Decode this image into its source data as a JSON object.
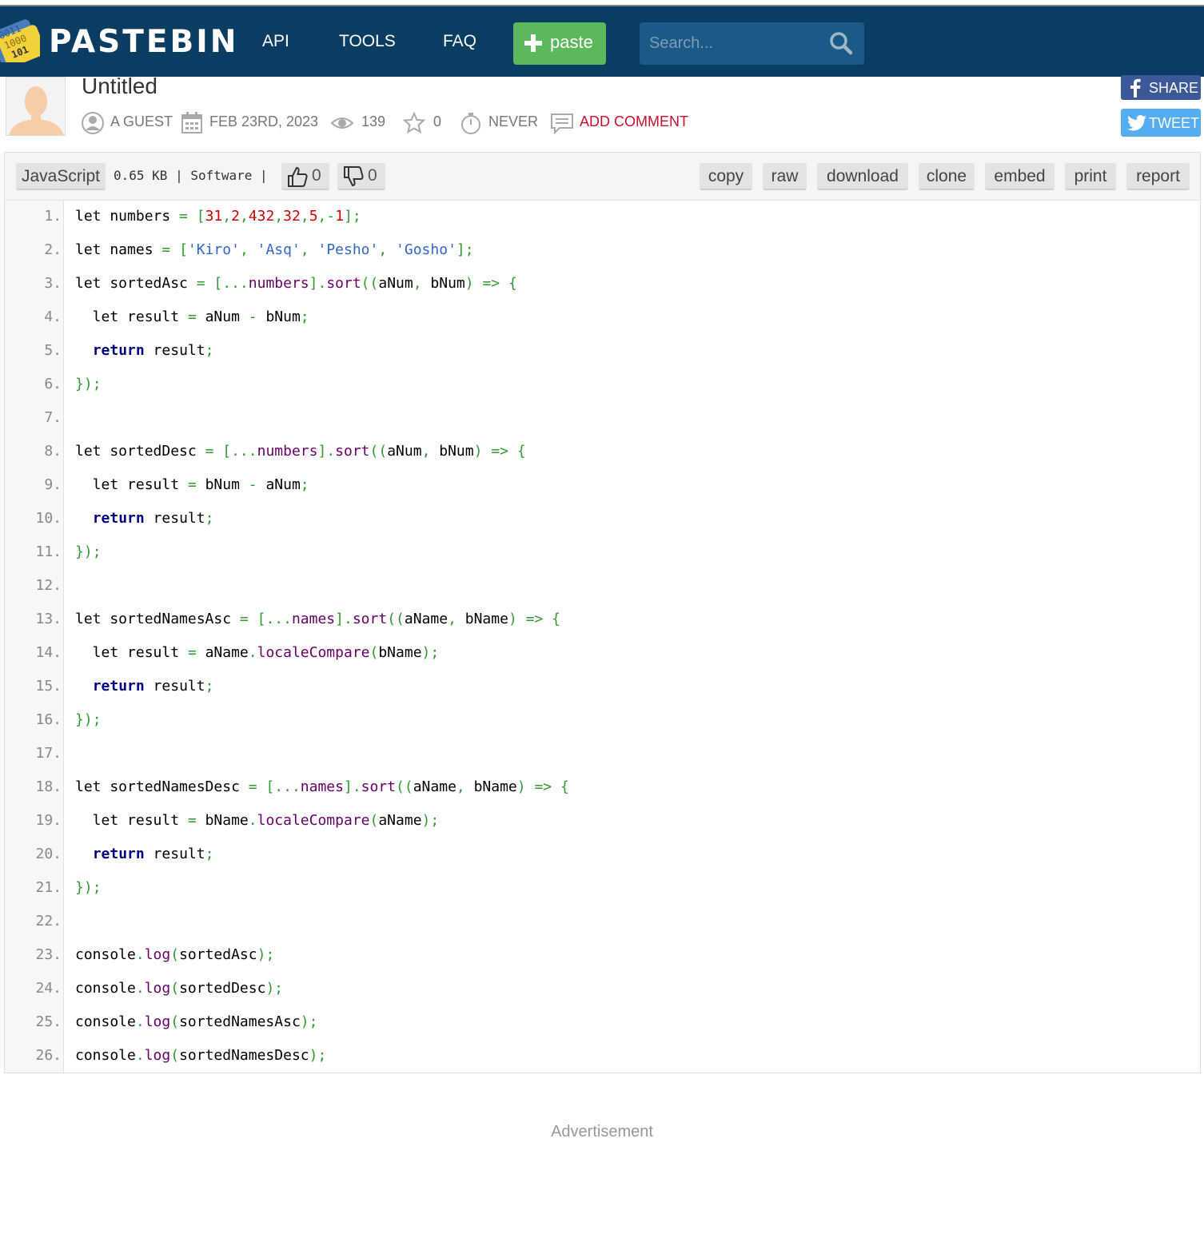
{
  "header": {
    "logo_text": "PASTEBIN",
    "nav": [
      {
        "label": "API"
      },
      {
        "label": "TOOLS"
      },
      {
        "label": "FAQ"
      }
    ],
    "paste_button": "paste",
    "search_placeholder": "Search..."
  },
  "paste": {
    "title": "Untitled",
    "author": "A GUEST",
    "date": "FEB 23RD, 2023",
    "views": "139",
    "stars": "0",
    "expiry": "NEVER",
    "add_comment": "ADD COMMENT"
  },
  "social": {
    "share": "SHARE",
    "tweet": "TWEET"
  },
  "code_header": {
    "language": "JavaScript",
    "size_and_category": "0.65 KB | Software |",
    "likes": "0",
    "dislikes": "0",
    "actions": [
      "copy",
      "raw",
      "download",
      "clone",
      "embed",
      "print",
      "report"
    ]
  },
  "code_lines": [
    "let numbers = [31,2,432,32,5,-1];",
    "let names = ['Kiro', 'Asq', 'Pesho', 'Gosho'];",
    "let sortedAsc = [...numbers].sort((aNum, bNum) => {",
    "  let result = aNum - bNum;",
    "  return result;",
    "});",
    "",
    "let sortedDesc = [...numbers].sort((aNum, bNum) => {",
    "  let result = bNum - aNum;",
    "  return result;",
    "});",
    "",
    "let sortedNamesAsc = [...names].sort((aName, bName) => {",
    "  let result = aName.localeCompare(bName);",
    "  return result;",
    "});",
    "",
    "let sortedNamesDesc = [...names].sort((aName, bName) => {",
    "  let result = bName.localeCompare(aName);",
    "  return result;",
    "});",
    "",
    "console.log(sortedAsc);",
    "console.log(sortedDesc);",
    "console.log(sortedNamesAsc);",
    "console.log(sortedNamesDesc);"
  ],
  "footer": {
    "advertisement": "Advertisement"
  },
  "colors": {
    "topbar": "#0b3d62",
    "paste_button": "#5cb85c",
    "facebook": "#3b5998",
    "twitter": "#55acee",
    "comment_link": "#c8102e"
  }
}
